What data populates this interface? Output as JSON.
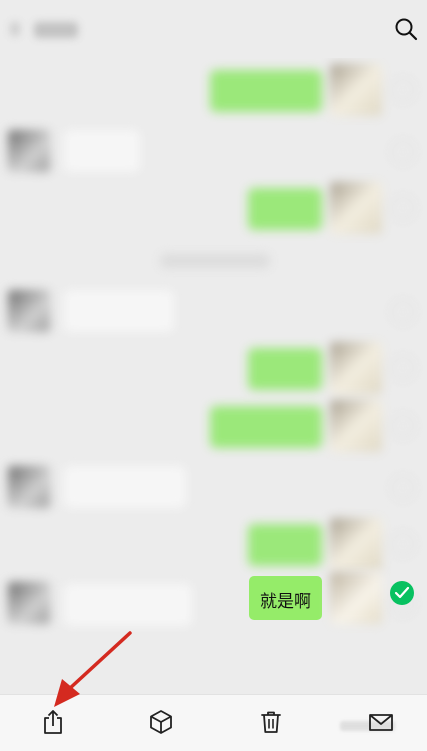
{
  "topbar": {
    "back_icon": "chevron-left-icon",
    "search_icon": "search-icon"
  },
  "messages": [
    {
      "side": "right"
    },
    {
      "side": "left"
    },
    {
      "side": "right"
    },
    {
      "type": "timestamp"
    },
    {
      "side": "left"
    },
    {
      "side": "right"
    },
    {
      "side": "right"
    },
    {
      "side": "left"
    },
    {
      "side": "right"
    },
    {
      "side": "left"
    },
    {
      "side": "right",
      "text": "就是啊",
      "selected": true
    }
  ],
  "selected_message": {
    "text": "就是啊",
    "selected": true
  },
  "bottom_toolbar": {
    "items": [
      {
        "icon": "share-icon"
      },
      {
        "icon": "box-icon"
      },
      {
        "icon": "trash-icon"
      },
      {
        "icon": "mail-icon"
      }
    ]
  },
  "colors": {
    "bubble_green": "#95ec69",
    "check_green": "#07c160",
    "background": "#ececec",
    "annotation_arrow": "#d42a20"
  }
}
